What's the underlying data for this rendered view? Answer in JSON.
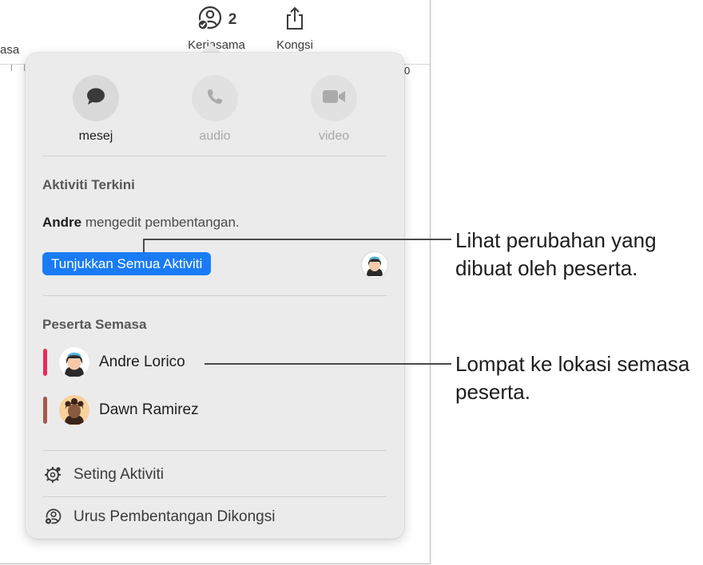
{
  "toolbar": {
    "partial_left_label": "asa",
    "collaborate_count": "2",
    "collaborate_label": "Kerjasama",
    "share_label": "Kongsi",
    "ruler_number": "0"
  },
  "popover": {
    "comm_buttons": [
      {
        "label": "mesej",
        "icon": "message-bubble-icon",
        "enabled": true
      },
      {
        "label": "audio",
        "icon": "phone-icon",
        "enabled": false
      },
      {
        "label": "video",
        "icon": "video-camera-icon",
        "enabled": false
      }
    ],
    "recent_activity": {
      "heading": "Aktiviti Terkini",
      "actor": "Andre",
      "action": " mengedit pembentangan.",
      "show_all_label": "Tunjukkan Semua Aktiviti"
    },
    "participants": {
      "heading": "Peserta Semasa",
      "items": [
        {
          "name": "Andre Lorico",
          "color": "#ee2a55"
        },
        {
          "name": "Dawn Ramirez",
          "color": "#a45a4b"
        }
      ]
    },
    "menu": {
      "activity_settings": "Seting Aktiviti",
      "manage_shared": "Urus Pembentangan Dikongsi"
    }
  },
  "callouts": {
    "changes": "Lihat perubahan yang dibuat oleh peserta.",
    "location": "Lompat ke lokasi semasa peserta."
  },
  "colors": {
    "accent": "#1a7cf5",
    "popover_bg": "#ebebeb"
  }
}
